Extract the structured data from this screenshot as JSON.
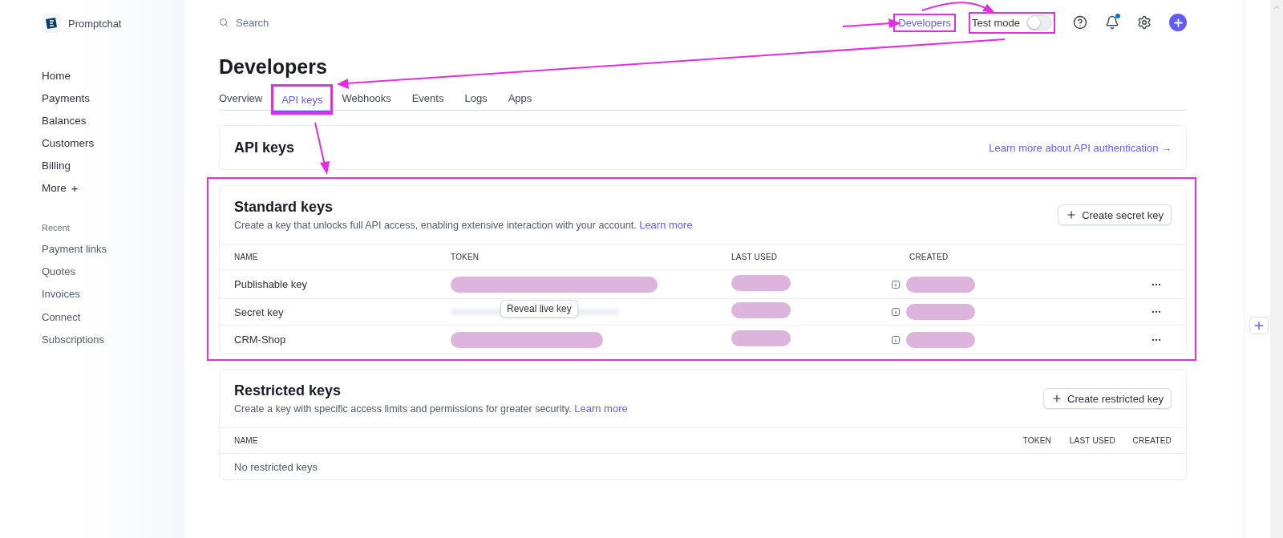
{
  "brand": {
    "name": "Promptchat"
  },
  "search": {
    "placeholder": "Search"
  },
  "topbar": {
    "developers_link": {
      "label": "Developers",
      "highlighted": true
    },
    "test_mode": {
      "label": "Test mode",
      "on": false,
      "highlighted": true
    },
    "notifications": {
      "unread": true
    }
  },
  "sidebar": {
    "items": [
      {
        "label": "Home"
      },
      {
        "label": "Payments"
      },
      {
        "label": "Balances"
      },
      {
        "label": "Customers"
      },
      {
        "label": "Billing"
      },
      {
        "label": "More",
        "kind": "more",
        "plus": "+"
      }
    ],
    "recent_heading": "Recent",
    "recent": [
      {
        "label": "Payment links"
      },
      {
        "label": "Quotes"
      },
      {
        "label": "Invoices"
      },
      {
        "label": "Connect"
      },
      {
        "label": "Subscriptions"
      }
    ]
  },
  "page": {
    "title": "Developers"
  },
  "tabs": [
    {
      "label": "Overview",
      "selected": false,
      "highlighted": false
    },
    {
      "label": "API keys",
      "selected": true,
      "highlighted": true
    },
    {
      "label": "Webhooks",
      "selected": false,
      "highlighted": false
    },
    {
      "label": "Events",
      "selected": false,
      "highlighted": false
    },
    {
      "label": "Logs",
      "selected": false,
      "highlighted": false
    },
    {
      "label": "Apps",
      "selected": false,
      "highlighted": false
    }
  ],
  "api_keys_card": {
    "title": "API keys",
    "link": "Learn more about API authentication →"
  },
  "standard_keys": {
    "title": "Standard keys",
    "highlighted": true,
    "description": "Create a key that unlocks full API access, enabling extensive interaction with your account.",
    "learn_more": "Learn more",
    "button": "Create secret key",
    "columns": [
      "NAME",
      "TOKEN",
      "LAST USED",
      "CREATED"
    ],
    "rows": [
      {
        "name": "Publishable key",
        "token_redacted": true,
        "last_used_redacted": true,
        "created_redacted": true
      },
      {
        "name": "Secret key",
        "token_blurred": true,
        "token_tooltip": "Reveal live key",
        "last_used_redacted": true,
        "created_redacted": true
      },
      {
        "name": "CRM-Shop",
        "token_redacted": true,
        "last_used_redacted": true,
        "created_redacted": true
      }
    ]
  },
  "restricted_keys": {
    "title": "Restricted keys",
    "description": "Create a key with specific access limits and permissions for greater security.",
    "learn_more": "Learn more",
    "button": "Create restricted key",
    "columns": [
      "NAME",
      "TOKEN",
      "LAST USED",
      "CREATED"
    ],
    "empty": "No restricted keys"
  },
  "annotation_arrows": [
    {
      "kind": "straight"
    },
    {
      "kind": "curved"
    },
    {
      "kind": "straight"
    },
    {
      "kind": "straight"
    }
  ]
}
